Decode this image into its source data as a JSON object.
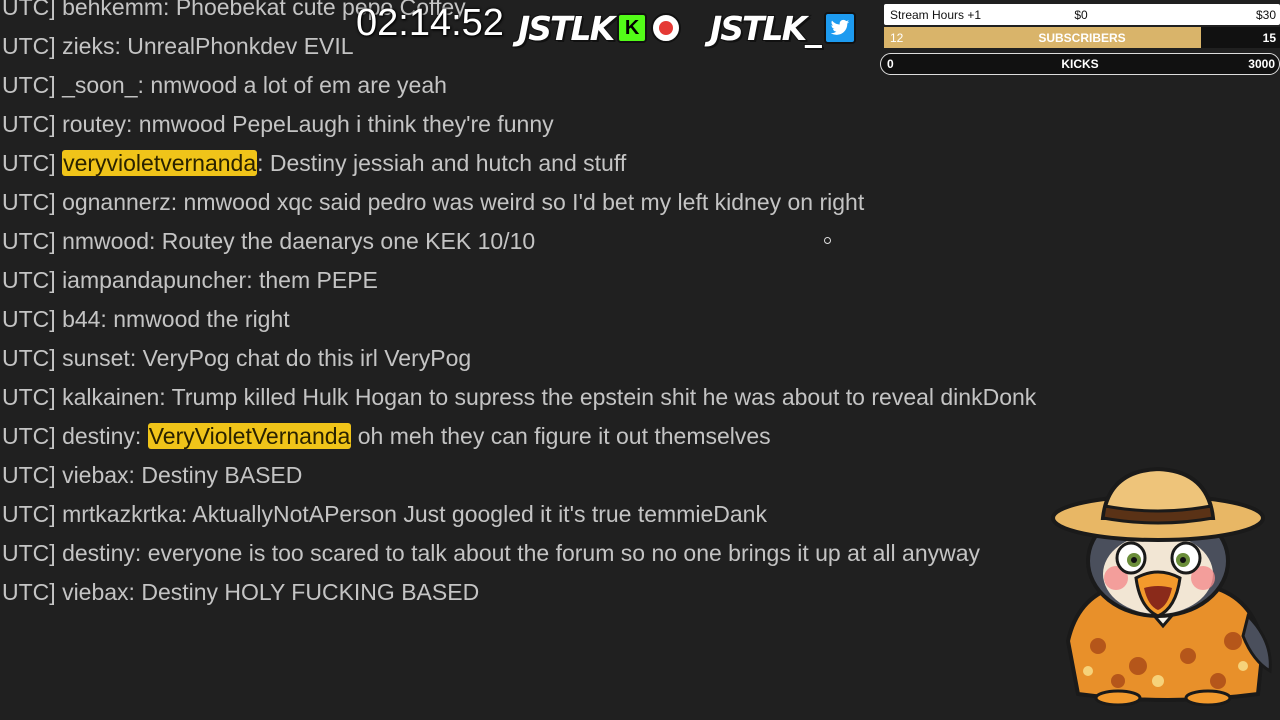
{
  "chat": {
    "lines": [
      {
        "prefix": "UTC] ",
        "user": "behkemm:",
        "msg": "Phoebekat cute pepo Coffey"
      },
      {
        "prefix": "UTC] ",
        "user": "zieks:",
        "msg": "UnrealPhonkdev EVIL"
      },
      {
        "prefix": "UTC] ",
        "user": "_soon_:",
        "msg": "nmwood a lot of em are yeah"
      },
      {
        "prefix": "UTC] ",
        "user": "routey:",
        "msg": "nmwood PepeLaugh i think they're funny"
      },
      {
        "prefix": "UTC] ",
        "user": "veryvioletvernanda",
        "msg": ": Destiny jessiah and hutch and stuff"
      },
      {
        "prefix": "UTC] ",
        "user": "ognannerz:",
        "msg": "nmwood xqc said pedro was weird so I'd bet my left kidney on right"
      },
      {
        "prefix": "UTC] ",
        "user": "nmwood:",
        "msg": "Routey the daenarys one KEK 10/10"
      },
      {
        "prefix": "UTC] ",
        "user": "iampandapuncher:",
        "msg": "them PEPE"
      },
      {
        "prefix": "UTC] ",
        "user": "b44:",
        "msg": "nmwood the right"
      },
      {
        "prefix": "UTC] ",
        "user": "sunset:",
        "msg": "VeryPog chat do this irl VeryPog"
      },
      {
        "prefix": "UTC] ",
        "user": "kalkainen:",
        "msg": "Trump killed Hulk Hogan to supress the epstein shit he was about to reveal dinkDonk"
      },
      {
        "prefix": "UTC] ",
        "user": "destiny:",
        "mention": "VeryVioletVernanda",
        "msg": "oh meh they can figure it out themselves"
      },
      {
        "prefix": "UTC] ",
        "user": "viebax:",
        "msg": "Destiny BASED"
      },
      {
        "prefix": "UTC] ",
        "user": "mrtkazkrtka:",
        "msg": "AktuallyNotAPerson Just googled it it's true temmieDank"
      },
      {
        "prefix": "UTC] ",
        "user": "destiny:",
        "msg": "everyone is too scared to talk about the forum so no one brings it up at all anyway"
      },
      {
        "prefix": "UTC] ",
        "user": "viebax:",
        "msg": "Destiny HOLY FUCKING BASED"
      }
    ],
    "highlight_color": "#f0c419"
  },
  "overlay": {
    "timer": "02:14:52",
    "brand_kick": "JSTLK",
    "kick_badge": "K",
    "brand_twitter": "JSTLK_",
    "icons": {
      "kick": "kick-logo-icon",
      "record": "record-icon",
      "twitter": "twitter-bird-icon"
    }
  },
  "goals": {
    "stream_hours": {
      "label": "Stream Hours +1",
      "current": "$0",
      "target": "$30"
    },
    "subscribers": {
      "label": "SUBSCRIBERS",
      "current": "12",
      "target": "15",
      "progress": 0.8
    },
    "kicks": {
      "label": "KICKS",
      "current": "0",
      "target": "3000",
      "progress": 0
    }
  },
  "colors": {
    "background": "#202020",
    "subs_fill": "#d9b46a",
    "kick_green": "#53fc18",
    "twitter_blue": "#1d9bf0"
  }
}
